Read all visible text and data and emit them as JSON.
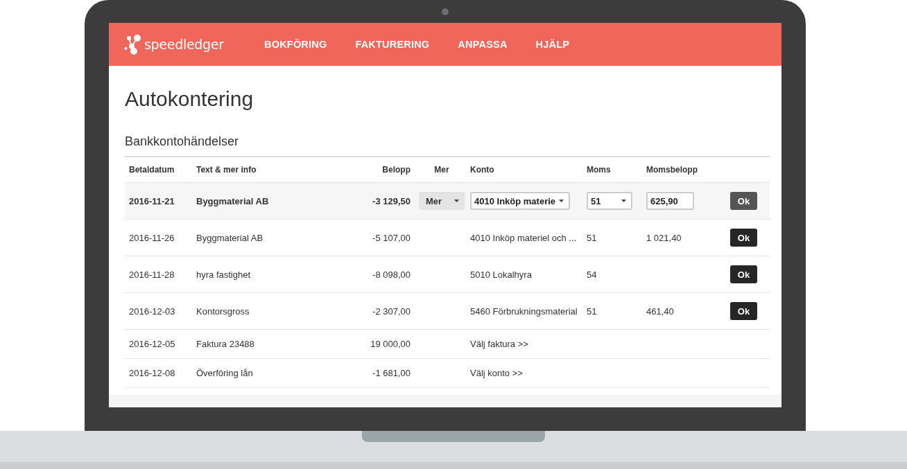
{
  "brand": "speedledger",
  "nav": [
    "BOKFÖRING",
    "FAKTURERING",
    "ANPASSA",
    "HJÄLP"
  ],
  "page_title": "Autokontering",
  "section_title": "Bankkontohändelser",
  "table": {
    "columns": [
      "Betaldatum",
      "Text & mer info",
      "Belopp",
      "Mer",
      "Konto",
      "Moms",
      "Momsbelopp"
    ],
    "rows": [
      {
        "kind": "editing",
        "selected": true,
        "date": "2016-11-21",
        "text": "Byggmaterial AB",
        "amount": "-3 129,50",
        "more": "Mer",
        "account": "4010 Inköp materie",
        "vat": "51",
        "vat_amount": "625,90",
        "action": "Ok"
      },
      {
        "kind": "suggested",
        "selected": false,
        "date": "2016-11-26",
        "text": "Byggmaterial AB",
        "amount": "-5 107,00",
        "account": "4010 Inköp materiel och ...",
        "vat": "51",
        "vat_amount": "1 021,40",
        "action": "Ok"
      },
      {
        "kind": "suggested",
        "selected": false,
        "date": "2016-11-28",
        "text": "hyra fastighet",
        "amount": "-8 098,00",
        "account": "5010 Lokalhyra",
        "vat": "54",
        "action": "Ok"
      },
      {
        "kind": "suggested",
        "selected": false,
        "date": "2016-12-03",
        "text": "Kontorsgross",
        "amount": "-2 307,00",
        "account": "5460 Förbrukningsmaterial",
        "vat": "51",
        "vat_amount": "461,40",
        "action": "Ok"
      },
      {
        "kind": "unmatched",
        "selected": false,
        "date": "2016-12-05",
        "text": "Faktura 23488",
        "amount": "19 000,00",
        "link": "Välj faktura >>"
      },
      {
        "kind": "unmatched",
        "selected": false,
        "date": "2016-12-08",
        "text": "Överföring lån",
        "amount": "-1 681,00",
        "link": "Välj konto >>"
      }
    ]
  }
}
